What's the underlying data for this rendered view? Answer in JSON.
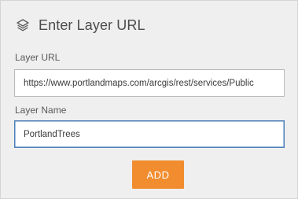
{
  "dialog": {
    "title": "Enter Layer URL",
    "icon": "layers-icon"
  },
  "layer_url": {
    "label": "Layer URL",
    "value": "https://www.portlandmaps.com/arcgis/rest/services/Public"
  },
  "layer_name": {
    "label": "Layer Name",
    "value": "PortlandTrees"
  },
  "actions": {
    "add_label": "ADD",
    "add_color": "#f18d2f"
  },
  "colors": {
    "panel_background": "#efefef",
    "focus_border": "#4a7fb8"
  }
}
